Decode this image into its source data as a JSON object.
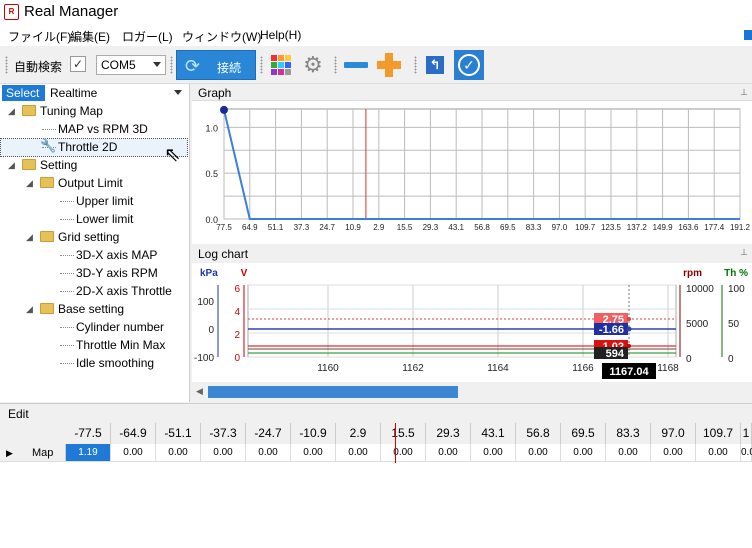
{
  "window": {
    "title": "Real Manager",
    "logo_text": "R"
  },
  "menu": [
    "ファイル(F)",
    "編集(E)",
    "ロガー(L)",
    "ウィンドウ(W)",
    "Help(H)"
  ],
  "toolbar": {
    "autosearch_label": "自動検索",
    "autosearch_checked": "✓",
    "com_port": "COM5",
    "connect_label": "接続"
  },
  "left_panel": {
    "select_label": "Select",
    "mode": "Realtime",
    "tree": [
      {
        "label": "Tuning Map",
        "type": "folder",
        "level": 0
      },
      {
        "label": "MAP vs RPM 3D",
        "type": "leaf",
        "level": 1
      },
      {
        "label": "Throttle 2D",
        "type": "leaf",
        "level": 1,
        "selected": true
      },
      {
        "label": "Setting",
        "type": "folder",
        "level": 0
      },
      {
        "label": "Output Limit",
        "type": "folder",
        "level": 1
      },
      {
        "label": "Upper limit",
        "type": "leaf",
        "level": 2
      },
      {
        "label": "Lower limit",
        "type": "leaf",
        "level": 2
      },
      {
        "label": "Grid setting",
        "type": "folder",
        "level": 1
      },
      {
        "label": "3D-X axis MAP",
        "type": "leaf",
        "level": 2
      },
      {
        "label": "3D-Y axis RPM",
        "type": "leaf",
        "level": 2
      },
      {
        "label": "2D-X axis Throttle",
        "type": "leaf",
        "level": 2
      },
      {
        "label": "Base setting",
        "type": "folder",
        "level": 1
      },
      {
        "label": "Cylinder number",
        "type": "leaf",
        "level": 2
      },
      {
        "label": "Throttle Min Max",
        "type": "leaf",
        "level": 2
      },
      {
        "label": "Idle smoothing",
        "type": "leaf",
        "level": 2
      }
    ]
  },
  "graph_panel": {
    "title": "Graph"
  },
  "log_panel": {
    "title": "Log chart"
  },
  "edit_panel": {
    "title": "Edit",
    "columns": [
      "-77.5",
      "-64.9",
      "-51.1",
      "-37.3",
      "-24.7",
      "-10.9",
      "2.9",
      "15.5",
      "29.3",
      "43.1",
      "56.8",
      "69.5",
      "83.3",
      "97.0",
      "109.7",
      "1"
    ],
    "row_label": "Map",
    "row_values": [
      "1.19",
      "0.00",
      "0.00",
      "0.00",
      "0.00",
      "0.00",
      "0.00",
      "0.00",
      "0.00",
      "0.00",
      "0.00",
      "0.00",
      "0.00",
      "0.00",
      "0.00",
      "0.00"
    ]
  },
  "chart_data": [
    {
      "type": "line",
      "x": [
        "77.5",
        "64.9",
        "51.1",
        "37.3",
        "24.7",
        "10.9",
        "2.9",
        "15.5",
        "29.3",
        "43.1",
        "56.8",
        "69.5",
        "83.3",
        "97.0",
        "109.7",
        "123.5",
        "137.2",
        "149.9",
        "163.6",
        "177.4",
        "191.2"
      ],
      "series": [
        {
          "values": [
            1.19,
            0,
            0,
            0,
            0,
            0,
            0,
            0,
            0,
            0,
            0,
            0,
            0,
            0,
            0,
            0,
            0,
            0,
            0,
            0,
            0
          ]
        }
      ],
      "yticks": [
        "0.0",
        "0.5",
        "1.0"
      ],
      "ylim": [
        0,
        1.2
      ],
      "cursor_x": "2.9",
      "color": "#3a7fdc"
    },
    {
      "type": "line",
      "xticks": [
        "1160",
        "1162",
        "1164",
        "1166",
        "1168"
      ],
      "cursor_value": "1167.04",
      "axes": {
        "kpa": {
          "label": "kPa",
          "ticks": [
            "100",
            "0",
            "-100"
          ],
          "color": "#2233aa"
        },
        "v": {
          "label": "V",
          "ticks": [
            "6",
            "4",
            "2",
            "0"
          ],
          "color": "#cc0000"
        },
        "rpm": {
          "label": "rpm",
          "ticks": [
            "10000",
            "5000",
            "0"
          ],
          "color": "#880000"
        },
        "th": {
          "label": "Th %",
          "ticks": [
            "100",
            "50",
            "0"
          ],
          "color": "#007700"
        }
      },
      "value_labels": [
        "2.75",
        "-1.66",
        "1.02",
        "594"
      ]
    }
  ]
}
